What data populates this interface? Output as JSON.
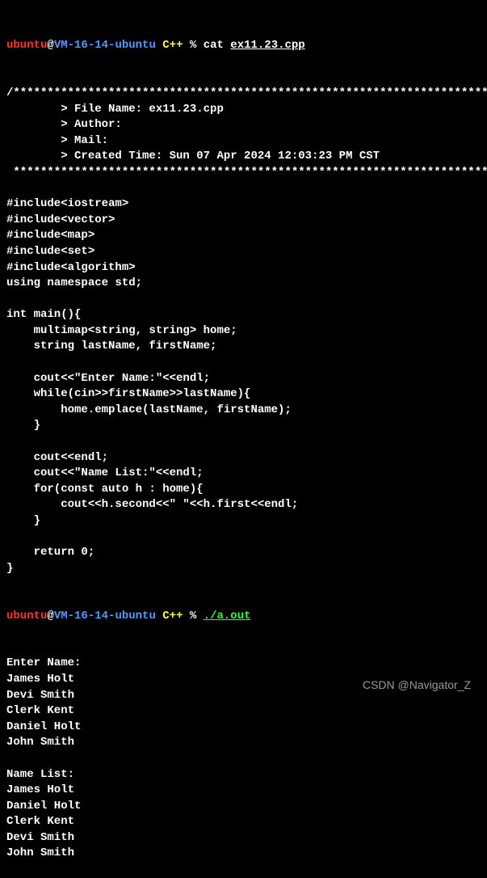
{
  "prompt1": {
    "user": "ubuntu",
    "at": "@",
    "host": "VM-16-14-ubuntu",
    "dir": " C++ ",
    "percent": "% ",
    "cmd": "cat ",
    "filename": "ex11.23.cpp"
  },
  "code": {
    "lines": [
      "/*************************************************************************",
      "        > File Name: ex11.23.cpp",
      "        > Author:",
      "        > Mail:",
      "        > Created Time: Sun 07 Apr 2024 12:03:23 PM CST",
      " ************************************************************************/",
      "",
      "#include<iostream>",
      "#include<vector>",
      "#include<map>",
      "#include<set>",
      "#include<algorithm>",
      "using namespace std;",
      "",
      "int main(){",
      "    multimap<string, string> home;",
      "    string lastName, firstName;",
      "",
      "    cout<<\"Enter Name:\"<<endl;",
      "    while(cin>>firstName>>lastName){",
      "        home.emplace(lastName, firstName);",
      "    }",
      "",
      "    cout<<endl;",
      "    cout<<\"Name List:\"<<endl;",
      "    for(const auto h : home){",
      "        cout<<h.second<<\" \"<<h.first<<endl;",
      "    }",
      "",
      "    return 0;",
      "}"
    ]
  },
  "prompt2": {
    "user": "ubuntu",
    "at": "@",
    "host": "VM-16-14-ubuntu",
    "dir": " C++ ",
    "percent": "% ",
    "exec": "./a.out"
  },
  "output": {
    "lines": [
      "Enter Name:",
      "James Holt",
      "Devi Smith",
      "Clerk Kent",
      "Daniel Holt",
      "John Smith",
      "",
      "Name List:",
      "James Holt",
      "Daniel Holt",
      "Clerk Kent",
      "Devi Smith",
      "John Smith"
    ]
  },
  "watermark": "CSDN @Navigator_Z"
}
